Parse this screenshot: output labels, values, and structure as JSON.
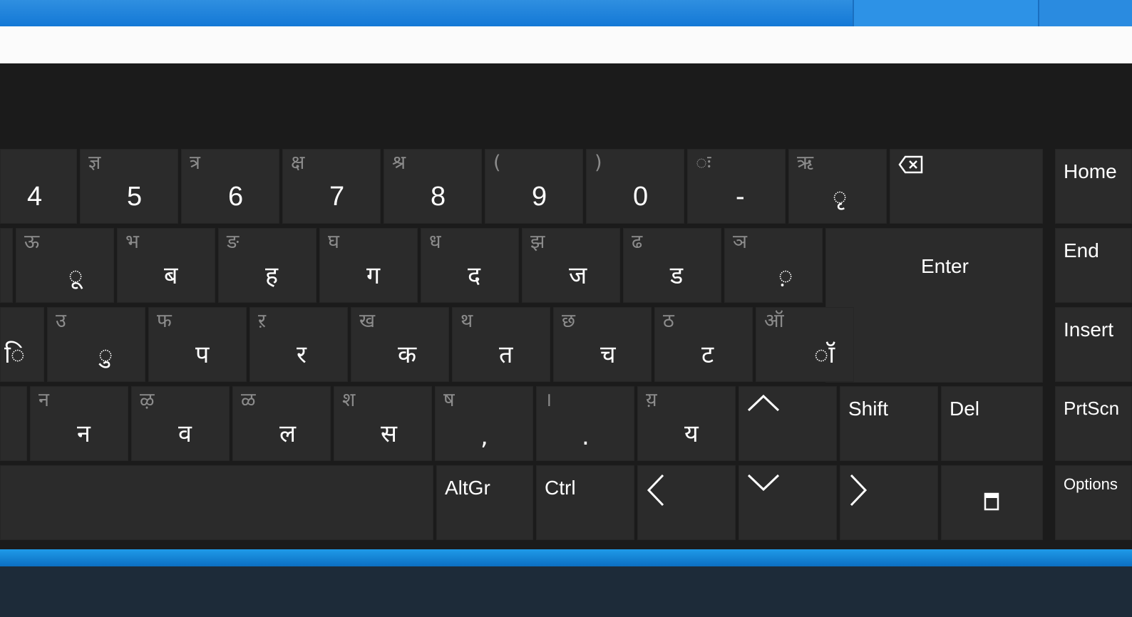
{
  "row1": [
    {
      "main": "4",
      "shift": ""
    },
    {
      "main": "5",
      "shift": "ज्ञ"
    },
    {
      "main": "6",
      "shift": "त्र"
    },
    {
      "main": "7",
      "shift": "क्ष"
    },
    {
      "main": "8",
      "shift": "श्र"
    },
    {
      "main": "9",
      "shift": "("
    },
    {
      "main": "0",
      "shift": ")"
    },
    {
      "main": "-",
      "shift": "ः"
    },
    {
      "main": "ृ",
      "shift": "ऋ"
    }
  ],
  "row2": [
    {
      "main": "ू",
      "shift": "ऊ"
    },
    {
      "main": "ब",
      "shift": "भ"
    },
    {
      "main": "ह",
      "shift": "ङ"
    },
    {
      "main": "ग",
      "shift": "घ"
    },
    {
      "main": "द",
      "shift": "ध"
    },
    {
      "main": "ज",
      "shift": "झ"
    },
    {
      "main": "ड",
      "shift": "ढ"
    },
    {
      "main": "़",
      "shift": "ञ"
    }
  ],
  "row3": [
    {
      "main": "ि",
      "shift": ""
    },
    {
      "main": "ु",
      "shift": "उ"
    },
    {
      "main": "प",
      "shift": "फ"
    },
    {
      "main": "र",
      "shift": "ऱ"
    },
    {
      "main": "क",
      "shift": "ख"
    },
    {
      "main": "त",
      "shift": "थ"
    },
    {
      "main": "च",
      "shift": "छ"
    },
    {
      "main": "ट",
      "shift": "ठ"
    },
    {
      "main": "ॉ",
      "shift": "ऑ"
    }
  ],
  "row4": [
    {
      "main": "न",
      "shift": "न"
    },
    {
      "main": "व",
      "shift": "ऴ"
    },
    {
      "main": "ल",
      "shift": "ळ"
    },
    {
      "main": "स",
      "shift": "श"
    },
    {
      "main": ",",
      "shift": "ष"
    },
    {
      "main": ".",
      "shift": "।"
    },
    {
      "main": "य",
      "shift": "य़"
    }
  ],
  "keys": {
    "enter": "Enter",
    "shift": "Shift",
    "del": "Del",
    "altgr": "AltGr",
    "ctrl": "Ctrl",
    "home": "Home",
    "end": "End",
    "insert": "Insert",
    "prtscn": "PrtScn",
    "options": "Options"
  },
  "icons": {
    "backspace": "backspace-icon",
    "up": "up-arrow-icon",
    "down": "down-arrow-icon",
    "left": "left-arrow-icon",
    "right": "right-arrow-icon",
    "fade": "fade-keyboard-icon"
  },
  "colors": {
    "key_bg": "#2b2b2b",
    "keyboard_bg": "#1b1b1b",
    "shift_text": "#8c8c8c",
    "taskbar_accent": "#1378d6"
  }
}
